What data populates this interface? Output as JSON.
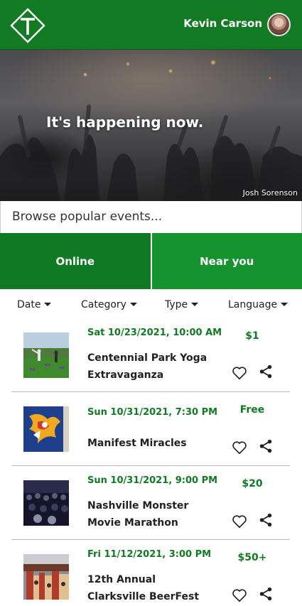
{
  "header": {
    "user_name": "Kevin Carson",
    "brand_color": "#117a22"
  },
  "hero": {
    "tagline": "It's happening now.",
    "photo_credit": "Josh Sorenson"
  },
  "browse": {
    "heading": "Browse popular events..."
  },
  "mode_tabs": [
    {
      "label": "Online"
    },
    {
      "label": "Near you"
    }
  ],
  "filters": [
    {
      "label": "Date"
    },
    {
      "label": "Category"
    },
    {
      "label": "Type"
    },
    {
      "label": "Language"
    }
  ],
  "events": [
    {
      "date": "Sat 10/23/2021, 10:00 AM",
      "title": "Centennial Park Yoga Extravaganza",
      "price": "$1",
      "thumb": "yoga-photo"
    },
    {
      "date": "Sun 10/31/2021, 7:30 PM",
      "title": "Manifest Miracles",
      "price": "Free",
      "thumb": "art-photo"
    },
    {
      "date": "Sun 10/31/2021, 9:00 PM",
      "title": "Nashville Monster Movie Marathon",
      "price": "$20",
      "thumb": "audience-photo"
    },
    {
      "date": "Fri 11/12/2021, 3:00 PM",
      "title": "12th Annual Clarksville BeerFest",
      "price": "$50+",
      "thumb": "beerfest-photo"
    }
  ]
}
